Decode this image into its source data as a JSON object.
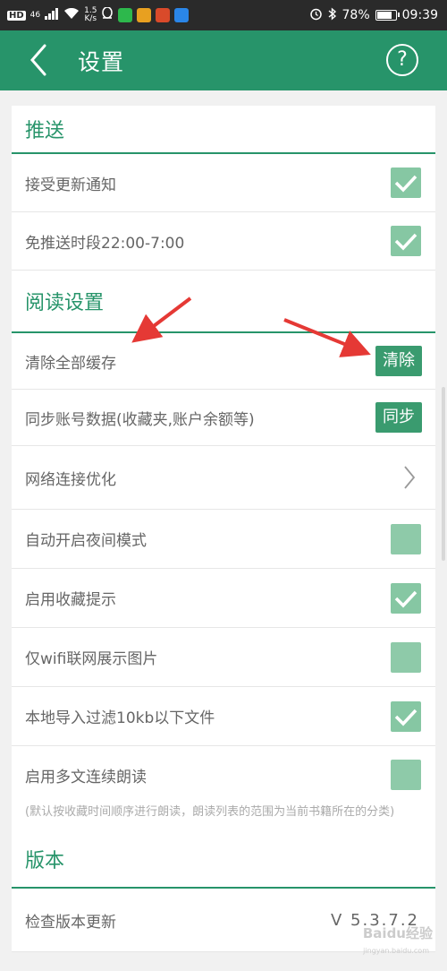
{
  "status_bar": {
    "hd": "HD",
    "net": "46",
    "speed": "1.5",
    "speed_unit": "K/s",
    "battery": "78%",
    "time": "09:39"
  },
  "header": {
    "title": "设置",
    "help_symbol": "?"
  },
  "sections": {
    "push": {
      "title": "推送",
      "items": [
        {
          "label": "接受更新通知",
          "checked": true
        },
        {
          "label": "免推送时段22:00-7:00",
          "checked": true
        }
      ]
    },
    "reading": {
      "title": "阅读设置",
      "clear_cache_label": "清除全部缓存",
      "clear_button": "清除",
      "sync_label": "同步账号数据(收藏夹,账户余额等)",
      "sync_button": "同步",
      "network_label": "网络连接优化",
      "night_mode_label": "自动开启夜间模式",
      "fav_tip_label": "启用收藏提示",
      "wifi_images_label": "仅wifi联网展示图片",
      "filter_label": "本地导入过滤10kb以下文件",
      "continuous_read_label": "启用多文连续朗读",
      "continuous_read_note": "(默认按收藏时间顺序进行朗读，朗读列表的范围为当前书籍所在的分类)"
    },
    "version": {
      "title": "版本",
      "check_label": "检查版本更新",
      "value": "V 5.3.7.2"
    }
  },
  "watermark": {
    "brand": "Baidu经验",
    "url": "jingyan.baidu.com"
  },
  "colors": {
    "accent": "#27946a",
    "check_fill": "#86c7a3",
    "arrow": "#e53935"
  }
}
